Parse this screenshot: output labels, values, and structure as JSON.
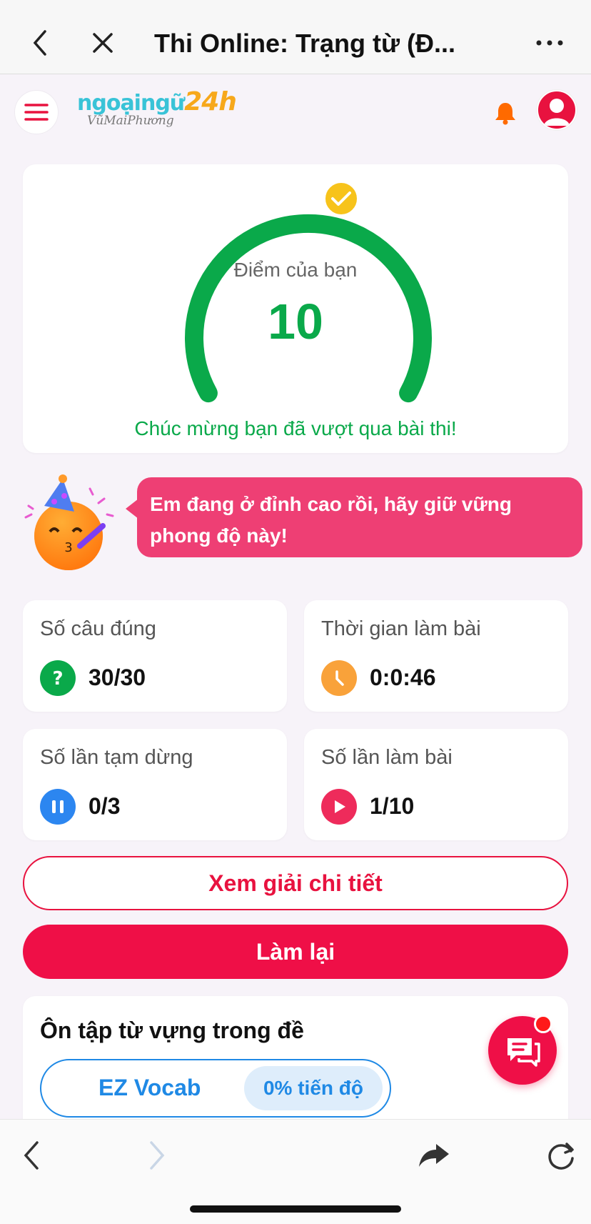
{
  "browser": {
    "title": "Thi Online: Trạng từ (Đ...",
    "icons": [
      "chevron-left-icon",
      "close-icon",
      "more-icon"
    ]
  },
  "header": {
    "logo_main": "ngoạingữ",
    "logo_num": "24h",
    "logo_sub": "VũMaiPhương"
  },
  "score": {
    "label": "Điểm của bạn",
    "value": "10",
    "message": "Chúc mừng bạn đã vượt qua bài thi!",
    "gauge_color": "#0aa94a",
    "badge_color": "#f7c31b"
  },
  "encouragement": "Em đang ở đỉnh cao rồi, hãy giữ vững phong độ này!",
  "stats": [
    {
      "label": "Số câu đúng",
      "value": "30/30",
      "icon": "question-icon",
      "color": "#0aa94a"
    },
    {
      "label": "Thời gian làm bài",
      "value": "0:0:46",
      "icon": "clock-icon",
      "color": "#f9a23a"
    },
    {
      "label": "Số lần tạm dừng",
      "value": "0/3",
      "icon": "pause-icon",
      "color": "#2c86f0"
    },
    {
      "label": "Số lần làm bài",
      "value": "1/10",
      "icon": "play-icon",
      "color": "#ee2b5b"
    }
  ],
  "actions": {
    "detail": "Xem giải chi tiết",
    "retry": "Làm lại"
  },
  "vocab": {
    "title": "Ôn tập từ vựng trong đề",
    "name": "EZ Vocab",
    "progress": "0% tiến độ"
  },
  "colors": {
    "accent": "#ef0f47",
    "green": "#0aa94a",
    "blue": "#1f89e5"
  }
}
